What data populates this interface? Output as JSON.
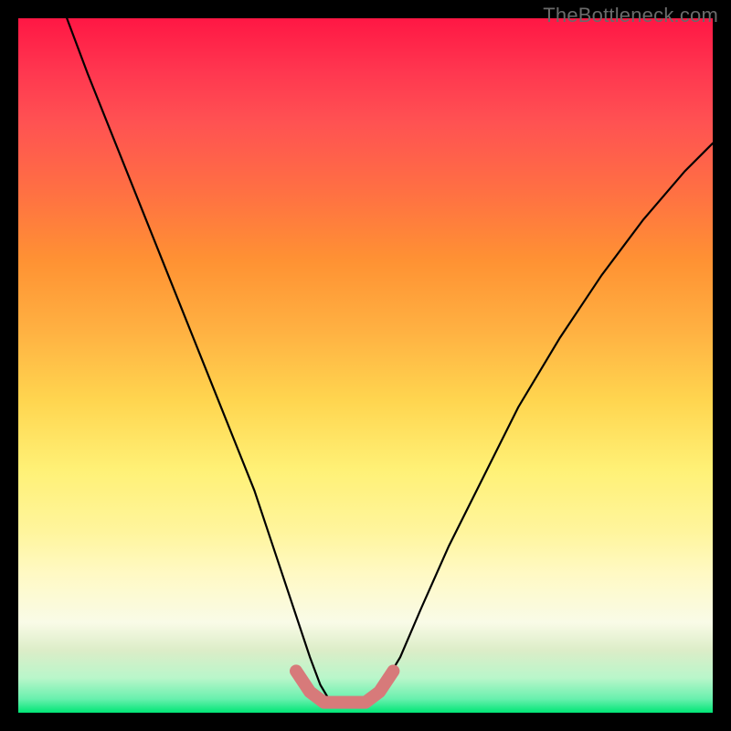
{
  "watermark": {
    "text": "TheBottleneck.com"
  },
  "chart_data": {
    "type": "line",
    "title": "",
    "xlabel": "",
    "ylabel": "",
    "xlim": [
      0,
      100
    ],
    "ylim": [
      0,
      100
    ],
    "grid": false,
    "series": [
      {
        "name": "bottleneck-curve",
        "color": "#000000",
        "x": [
          7,
          10,
          14,
          18,
          22,
          26,
          30,
          34,
          37,
          40,
          42,
          43.5,
          45,
          48,
          50,
          52,
          55,
          58,
          62,
          67,
          72,
          78,
          84,
          90,
          96,
          100
        ],
        "y": [
          100,
          92,
          82,
          72,
          62,
          52,
          42,
          32,
          23,
          14,
          8,
          4,
          1.5,
          1.5,
          1.5,
          3,
          8,
          15,
          24,
          34,
          44,
          54,
          63,
          71,
          78,
          82
        ]
      },
      {
        "name": "bottom-highlight",
        "color": "#d77a7a",
        "x": [
          40,
          42,
          44,
          46,
          48,
          50,
          52,
          54
        ],
        "y": [
          6,
          3,
          1.5,
          1.5,
          1.5,
          1.5,
          3,
          6
        ]
      }
    ],
    "gradient_stops": [
      {
        "pos": 0,
        "color": "#ff1744"
      },
      {
        "pos": 50,
        "color": "#ffd54f"
      },
      {
        "pos": 100,
        "color": "#00e676"
      }
    ]
  }
}
